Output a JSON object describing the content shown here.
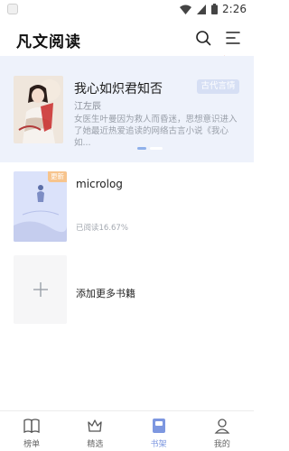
{
  "status_bar": {
    "time": "2:26"
  },
  "app": {
    "title": "凡文阅读"
  },
  "banner": {
    "title": "我心如炽君知否",
    "author": "江左辰",
    "genre": "古代言情",
    "description": "女医生叶曼因为救人而昏迷，思想意识进入了她最近热爱追读的网络古言小说《我心如..."
  },
  "shelf": {
    "books": [
      {
        "name": "microlog",
        "badge": "更新",
        "progress": "已阅读16.67%"
      }
    ],
    "add_label": "添加更多书籍"
  },
  "bottom_nav": {
    "items": [
      {
        "label": "榜单"
      },
      {
        "label": "精选"
      },
      {
        "label": "书架"
      },
      {
        "label": "我的"
      }
    ],
    "active_index": 2
  },
  "colors": {
    "accent": "#7d97e0",
    "banner_bg": "#eef2fb",
    "badge": "#f7c48d"
  },
  "icons": [
    "search-icon",
    "menu-icon",
    "plus-icon",
    "book-icon",
    "crown-icon",
    "bookshelf-icon",
    "user-icon",
    "wifi-icon",
    "signal-icon",
    "battery-icon"
  ]
}
